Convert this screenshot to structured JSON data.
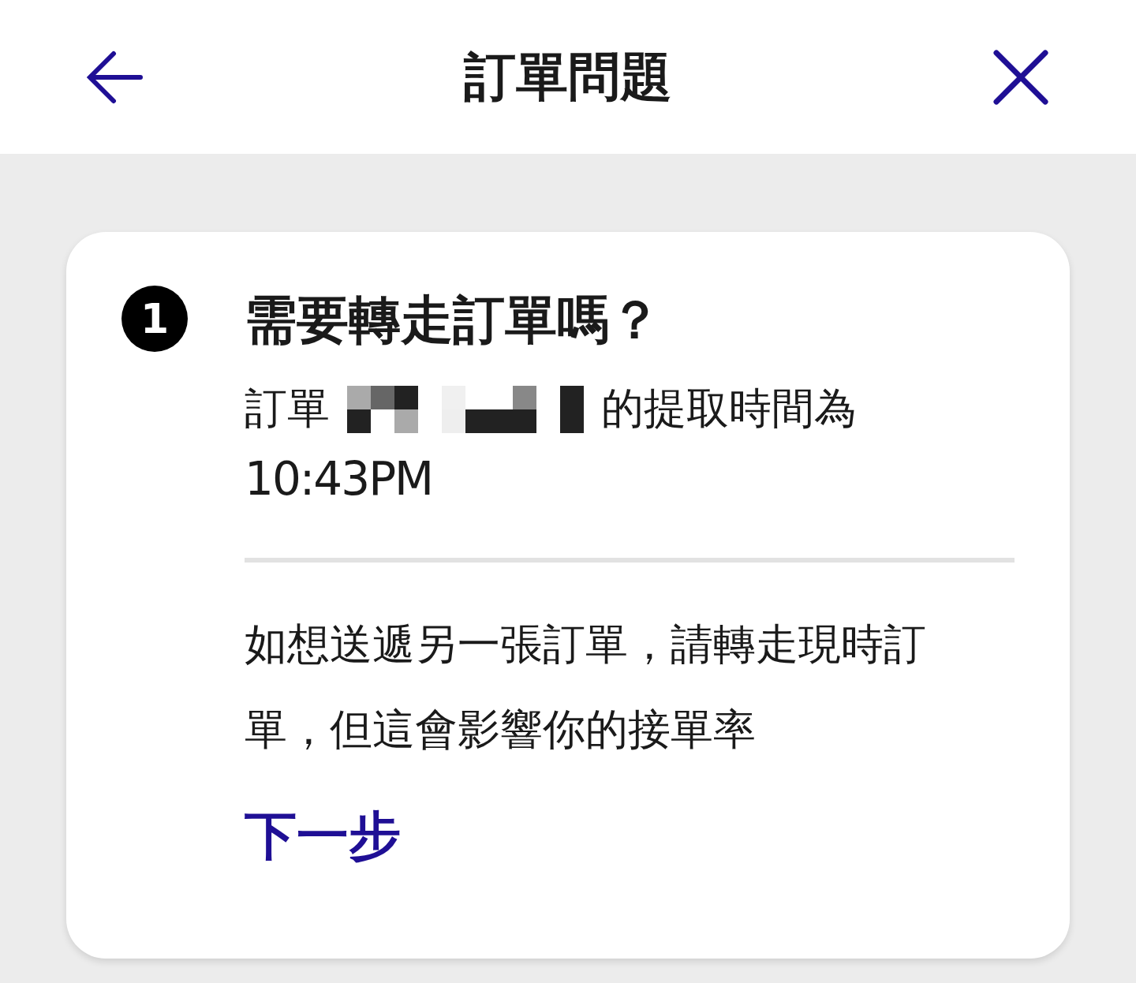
{
  "header": {
    "title": "訂單問題"
  },
  "step": {
    "number": "1",
    "title": "需要轉走訂單嗎？",
    "order_prefix": "訂單",
    "order_suffix": "的提取時間為",
    "pickup_time": "10:43PM",
    "message": "如想送遞另一張訂單，請轉走現時訂單，但這會影響你的接單率",
    "next_link": "下一步"
  }
}
